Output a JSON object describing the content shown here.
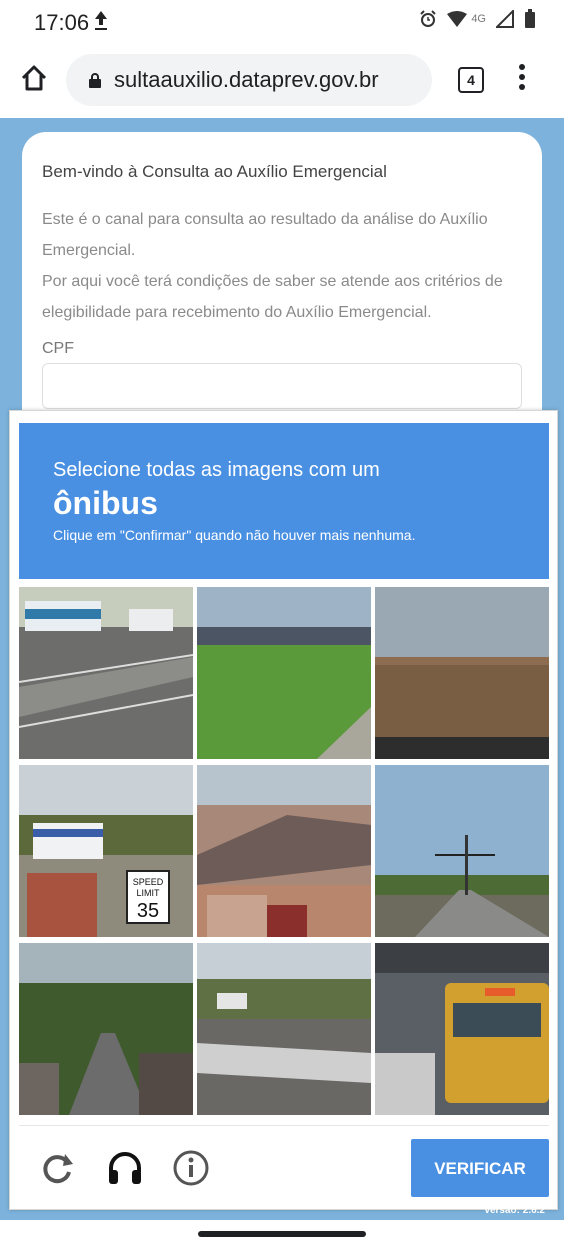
{
  "status_bar": {
    "time": "17:06",
    "network": "4G",
    "icons": [
      "upload-icon",
      "alarm-icon",
      "wifi-icon",
      "signal-icon",
      "battery-icon"
    ]
  },
  "browser": {
    "url": "sultaauxilio.dataprev.gov.br",
    "tab_count": "4",
    "icons": [
      "home-icon",
      "lock-icon",
      "menu-icon"
    ]
  },
  "form": {
    "title": "Bem-vindo à Consulta ao Auxílio Emergencial",
    "paragraph1": "Este é o canal para consulta ao resultado da análise do Auxílio Emergencial.",
    "paragraph2": "Por aqui você terá condições de saber se atende aos critérios de elegibilidade para recebimento do Auxílio Emergencial.",
    "cpf_label": "CPF",
    "cpf_value": ""
  },
  "captcha": {
    "instruction_line1": "Selecione todas as imagens com um",
    "target": "ônibus",
    "instruction_line3": "Clique em \"Confirmar\" quando não houver mais nenhuma.",
    "tiles": [
      {
        "name": "tile-1",
        "sign": ""
      },
      {
        "name": "tile-2",
        "sign": ""
      },
      {
        "name": "tile-3",
        "sign": ""
      },
      {
        "name": "tile-4",
        "sign_lines": [
          "SPEED",
          "LIMIT",
          "35"
        ]
      },
      {
        "name": "tile-5",
        "sign": ""
      },
      {
        "name": "tile-6",
        "sign": ""
      },
      {
        "name": "tile-7",
        "sign": ""
      },
      {
        "name": "tile-8",
        "sign": ""
      },
      {
        "name": "tile-9",
        "sign": ""
      }
    ],
    "verify_label": "VERIFICAR",
    "version": "Versão: 2.6.2",
    "footer_icons": [
      "reload-icon",
      "headphones-icon",
      "info-icon"
    ],
    "colors": {
      "accent": "#4a90e2",
      "page_background": "#7cb2dc"
    }
  }
}
